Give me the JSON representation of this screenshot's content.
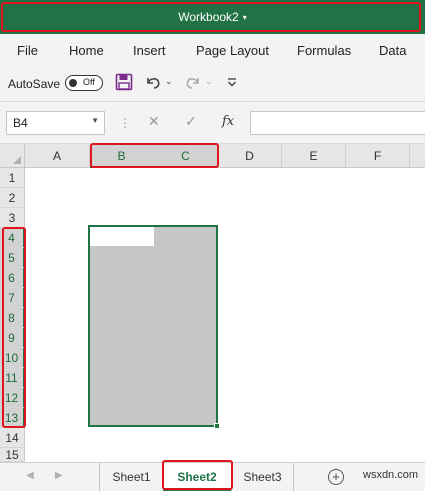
{
  "window": {
    "title": "Workbook2",
    "title_caret": "▾"
  },
  "menu": [
    "File",
    "Home",
    "Insert",
    "Page Layout",
    "Formulas",
    "Data"
  ],
  "qat": {
    "autosave_label": "AutoSave",
    "autosave_state": "Off",
    "save_icon": "save-icon",
    "undo_icon": "undo-icon",
    "redo_icon": "redo-icon",
    "customize_icon": "customize-qat-icon"
  },
  "formula_bar": {
    "name_box": "B4",
    "cancel_glyph": "✕",
    "enter_glyph": "✓",
    "fx_label": "fx",
    "formula_value": ""
  },
  "columns": [
    "A",
    "B",
    "C",
    "D",
    "E",
    "F"
  ],
  "selected_columns": [
    "B",
    "C"
  ],
  "rows": [
    "1",
    "2",
    "3",
    "4",
    "5",
    "6",
    "7",
    "8",
    "9",
    "10",
    "11",
    "12",
    "13",
    "14",
    "15"
  ],
  "selected_rows": [
    "4",
    "5",
    "6",
    "7",
    "8",
    "9",
    "10",
    "11",
    "12",
    "13"
  ],
  "selection": {
    "range": "B4:C13",
    "active_cell": "B4"
  },
  "sheets": [
    "Sheet1",
    "Sheet2",
    "Sheet3"
  ],
  "active_sheet": "Sheet2",
  "add_sheet_glyph": "+",
  "watermark": "wsxdn.com",
  "colors": {
    "excel_green": "#217346",
    "highlight_red": "#e0141e"
  }
}
